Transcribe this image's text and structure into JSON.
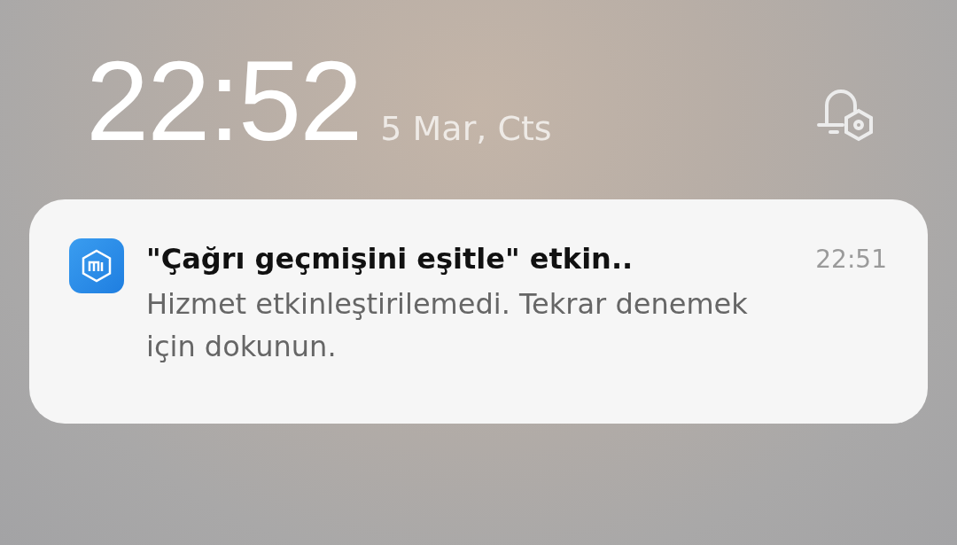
{
  "lockscreen": {
    "time": "22:52",
    "date": "5 Mar, Cts"
  },
  "notification": {
    "title": "\"Çağrı geçmişini eşitle\" etkin..",
    "time": "22:51",
    "body": "Hizmet etkinleştirilemedi. Tekrar denemek için dokunun."
  }
}
